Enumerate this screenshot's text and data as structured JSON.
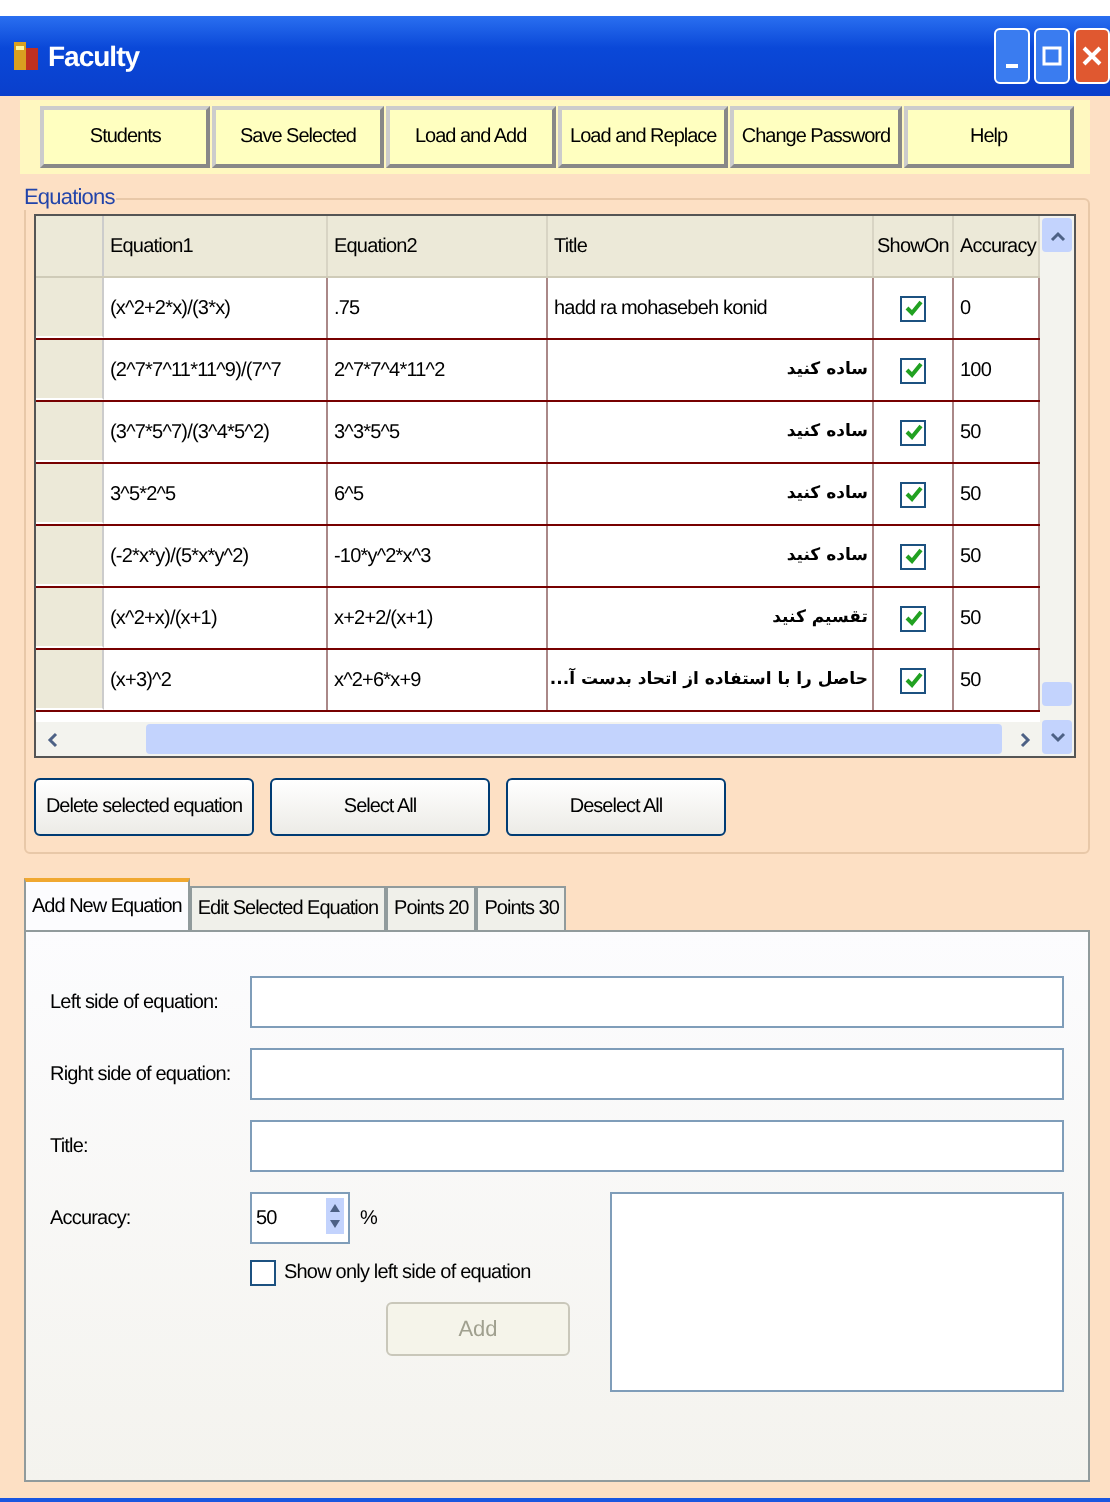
{
  "window": {
    "title": "Faculty"
  },
  "toolbar": [
    "Students",
    "Save Selected",
    "Load and Add",
    "Load and Replace",
    "Change Password",
    "Help"
  ],
  "equations": {
    "title": "Equations",
    "columns": [
      "Equation1",
      "Equation2",
      "Title",
      "ShowOn",
      "Accuracy"
    ],
    "rows": [
      {
        "equation1": "(x^2+2*x)/(3*x)",
        "equation2": ".75",
        "title": "hadd ra mohasebeh konid",
        "show_on": true,
        "accuracy": "0"
      },
      {
        "equation1": "(2^7*7^11*11^9)/(7^7",
        "equation2": "2^7*7^4*11^2",
        "title": "ساده کنید",
        "show_on": true,
        "accuracy": "100"
      },
      {
        "equation1": "(3^7*5^7)/(3^4*5^2)",
        "equation2": "3^3*5^5",
        "title": "ساده کنید",
        "show_on": true,
        "accuracy": "50"
      },
      {
        "equation1": "3^5*2^5",
        "equation2": "6^5",
        "title": "ساده کنید",
        "show_on": true,
        "accuracy": "50"
      },
      {
        "equation1": "(-2*x*y)/(5*x*y^2)",
        "equation2": "-10*y^2*x^3",
        "title": "ساده کنید",
        "show_on": true,
        "accuracy": "50"
      },
      {
        "equation1": "(x^2+x)/(x+1)",
        "equation2": "x+2+2/(x+1)",
        "title": "تقسیم کنید",
        "show_on": true,
        "accuracy": "50"
      },
      {
        "equation1": "(x+3)^2",
        "equation2": "x^2+6*x+9",
        "title": "حاصل را با استفاده از اتحاد بدست آ...",
        "show_on": true,
        "accuracy": "50"
      }
    ],
    "buttons": [
      "Delete selected equation",
      "Select All",
      "Deselect All"
    ]
  },
  "tabs": [
    {
      "label": "Add New Equation",
      "selected": true
    },
    {
      "label": "Edit Selected Equation",
      "selected": false
    },
    {
      "label": "Points 20",
      "selected": false
    },
    {
      "label": "Points 30",
      "selected": false
    }
  ],
  "form": {
    "left_label": "Left side of equation:",
    "right_label": "Right side of equation:",
    "title_label": "Title:",
    "accuracy_label": "Accuracy:",
    "accuracy_value": "50",
    "percent": "%",
    "show_only_left": {
      "label": "Show only left side of equation",
      "checked": false
    },
    "add_button": {
      "label": "Add",
      "disabled": true
    }
  }
}
